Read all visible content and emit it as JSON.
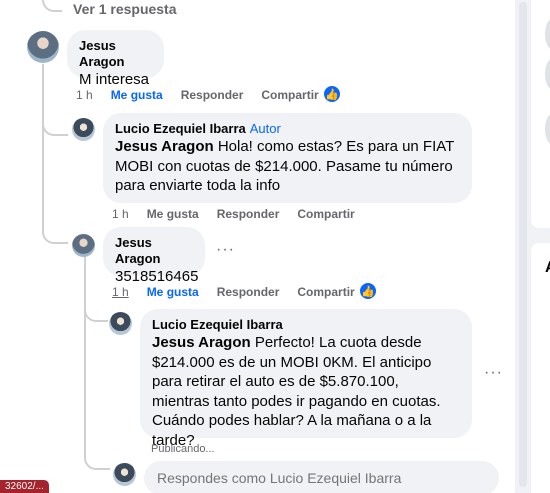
{
  "view_more_label": "Ver 1 respuesta",
  "comments": [
    {
      "author": "Jesus Aragon",
      "text": "M interesa",
      "time": "1 h",
      "like_label": "Me gusta",
      "reply_label": "Responder",
      "share_label": "Compartir",
      "reaction": "like"
    },
    {
      "author": "Lucio Ezequiel Ibarra",
      "author_badge": "Autor",
      "mention": "Jesus Aragon",
      "text": " Hola! como estas? Es para un FIAT MOBI con cuotas de $214.000. Pasame tu número para enviarte toda la info",
      "time": "1 h",
      "like_label": "Me gusta",
      "reply_label": "Responder",
      "share_label": "Compartir"
    },
    {
      "author": "Jesus Aragon",
      "text": "3518516465",
      "time": "1 h",
      "like_label": "Me gusta",
      "reply_label": "Responder",
      "share_label": "Compartir",
      "reaction": "like"
    },
    {
      "author": "Lucio Ezequiel Ibarra",
      "mention": "Jesus Aragon",
      "text": " Perfecto! La cuota desde $214.000 es de un MOBI 0KM. El anticipo para retirar el auto es de $5.870.100, mientras tanto podes ir pagando en cuotas. Cuándo podes hablar? A la mañana o a la tarde?",
      "status": "Publicando..."
    }
  ],
  "reply_input": {
    "placeholder": "Respondes como Lucio Ezequiel Ibarra"
  },
  "sidebar_letter": "A",
  "status_url": "32602/...",
  "colors": {
    "link_blue": "#0866ff",
    "bubble_bg": "#f0f2f5",
    "muted_text": "#65676b"
  }
}
